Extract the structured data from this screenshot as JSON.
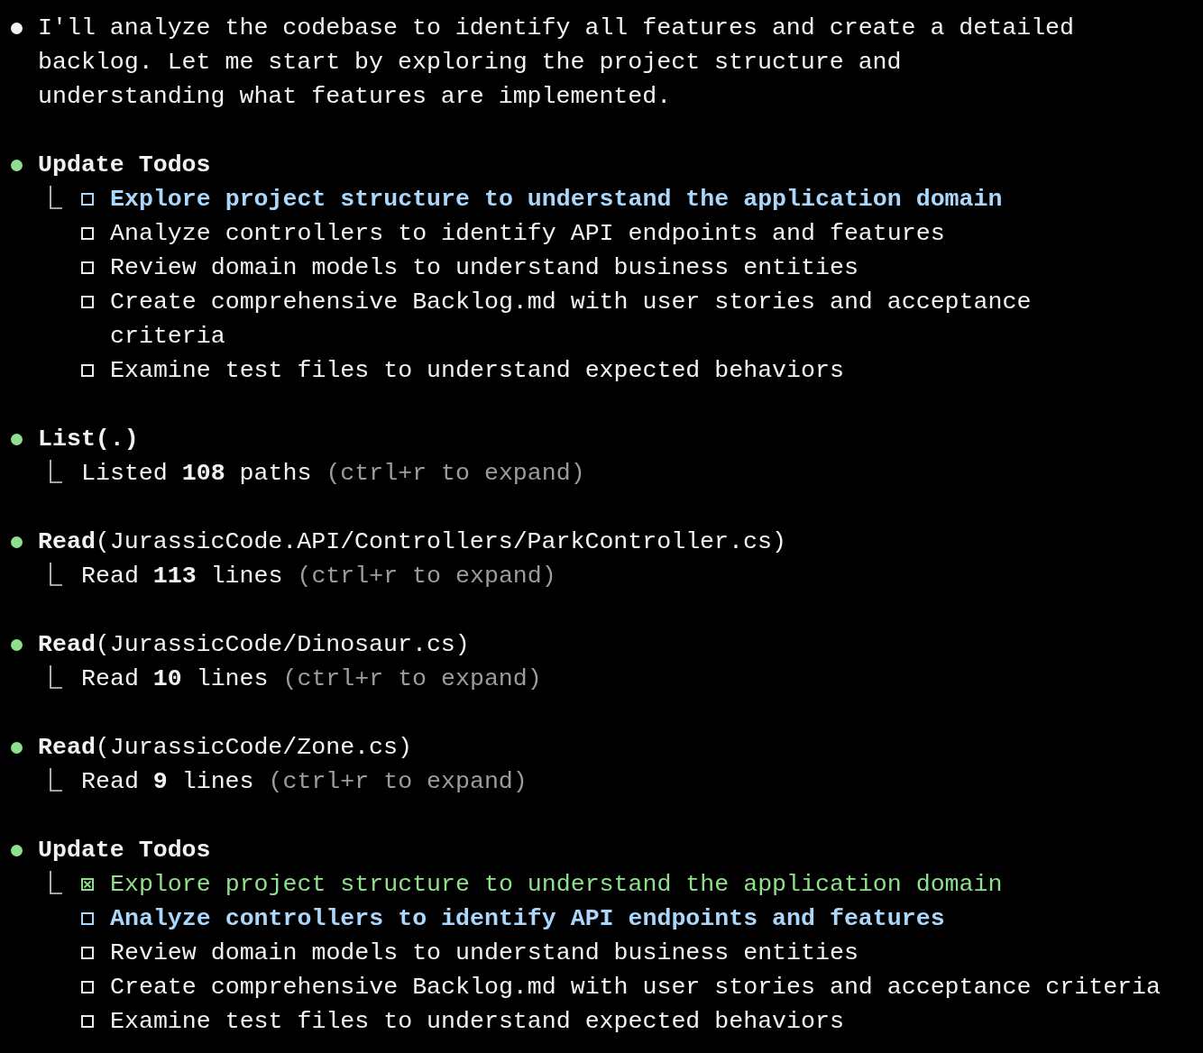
{
  "entries": [
    {
      "kind": "message",
      "text": "I'll analyze the codebase to identify all features and create a detailed backlog. Let me start by exploring the project structure and understanding what features are implemented."
    },
    {
      "kind": "todos",
      "title": "Update Todos",
      "items": [
        {
          "text": "Explore project structure to understand the application domain",
          "checked": false,
          "active": true
        },
        {
          "text": "Analyze controllers to identify API endpoints and features",
          "checked": false,
          "active": false
        },
        {
          "text": "Review domain models to understand business entities",
          "checked": false,
          "active": false
        },
        {
          "text": "Create comprehensive Backlog.md with user stories and acceptance criteria",
          "checked": false,
          "active": false
        },
        {
          "text": "Examine test files to understand expected behaviors",
          "checked": false,
          "active": false
        }
      ]
    },
    {
      "kind": "tool",
      "call": "**List(.)**",
      "result": "Listed **108** paths",
      "hint": "(ctrl+r to expand)"
    },
    {
      "kind": "tool",
      "call": "**Read**(JurassicCode.API/Controllers/ParkController.cs)",
      "result": "Read **113** lines",
      "hint": "(ctrl+r to expand)"
    },
    {
      "kind": "tool",
      "call": "**Read**(JurassicCode/Dinosaur.cs)",
      "result": "Read **10** lines",
      "hint": "(ctrl+r to expand)"
    },
    {
      "kind": "tool",
      "call": "**Read**(JurassicCode/Zone.cs)",
      "result": "Read **9** lines",
      "hint": "(ctrl+r to expand)"
    },
    {
      "kind": "todos",
      "title": "Update Todos",
      "items": [
        {
          "text": "Explore project structure to understand the application domain",
          "checked": true,
          "active": false
        },
        {
          "text": "Analyze controllers to identify API endpoints and features",
          "checked": false,
          "active": true
        },
        {
          "text": "Review domain models to understand business entities",
          "checked": false,
          "active": false
        },
        {
          "text": "Create comprehensive Backlog.md with user stories and acceptance criteria",
          "checked": false,
          "active": false
        },
        {
          "text": "Examine test files to understand expected behaviors",
          "checked": false,
          "active": false
        }
      ]
    }
  ]
}
